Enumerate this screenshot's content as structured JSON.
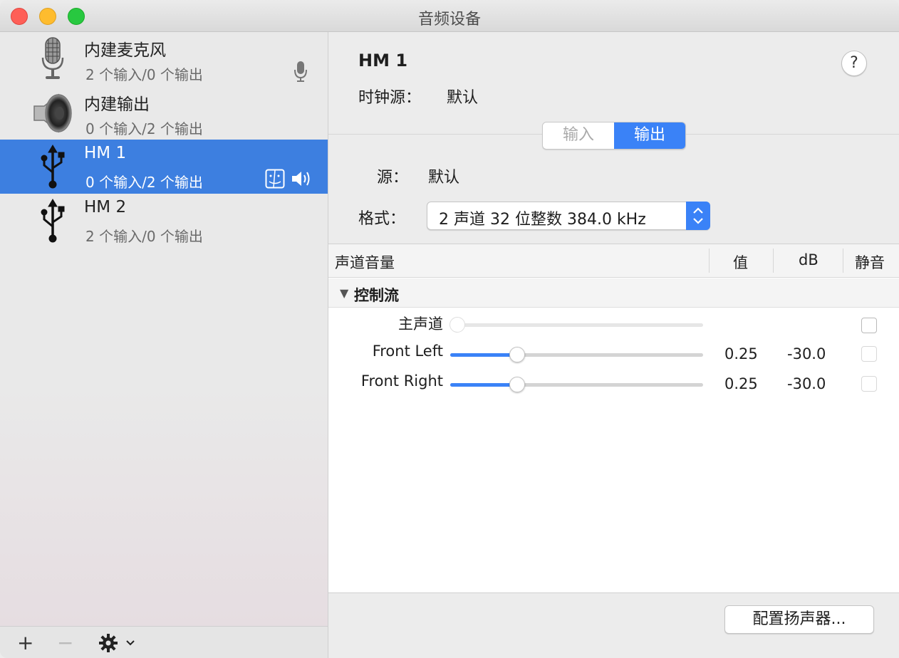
{
  "window": {
    "title": "音频设备"
  },
  "devices": [
    {
      "name": "内建麦克风",
      "io": "2 个输入/0 个输出",
      "icon": "microphone-icon",
      "badge": "mic-icon",
      "selected": false
    },
    {
      "name": "内建输出",
      "io": "0 个输入/2 个输出",
      "icon": "speaker-icon",
      "badge": "",
      "selected": false
    },
    {
      "name": "HM 1",
      "io": "0 个输入/2 个输出",
      "icon": "usb-icon",
      "badge": "finder-icon, volume-icon",
      "selected": true
    },
    {
      "name": "HM 2",
      "io": "2 个输入/0 个输出",
      "icon": "usb-icon",
      "badge": "",
      "selected": false
    }
  ],
  "sidebar_toolbar": {
    "add": "+",
    "remove": "−"
  },
  "detail": {
    "title": "HM 1",
    "help": "?",
    "clock_label": "时钟源：",
    "clock_value": "默认",
    "tab_input": "输入",
    "tab_output": "输出",
    "source_label": "源：",
    "source_value": "默认",
    "format_label": "格式：",
    "format_value": "2 声道 32 位整数 384.0 kHz"
  },
  "table": {
    "headers": {
      "channel": "声道音量",
      "value": "值",
      "db": "dB",
      "mute": "静音"
    },
    "group": "控制流",
    "group_triangle": "▼",
    "rows": [
      {
        "label": "主声道",
        "value": "",
        "db": "",
        "level": 0.0,
        "enabled": false
      },
      {
        "label": "Front Left",
        "value": "0.25",
        "db": "-30.0",
        "level": 0.25,
        "enabled": true
      },
      {
        "label": "Front Right",
        "value": "0.25",
        "db": "-30.0",
        "level": 0.25,
        "enabled": true
      }
    ]
  },
  "configure_button": "配置扬声器...",
  "colors": {
    "accent": "#3a82f7",
    "selection": "#3d7fe0"
  }
}
